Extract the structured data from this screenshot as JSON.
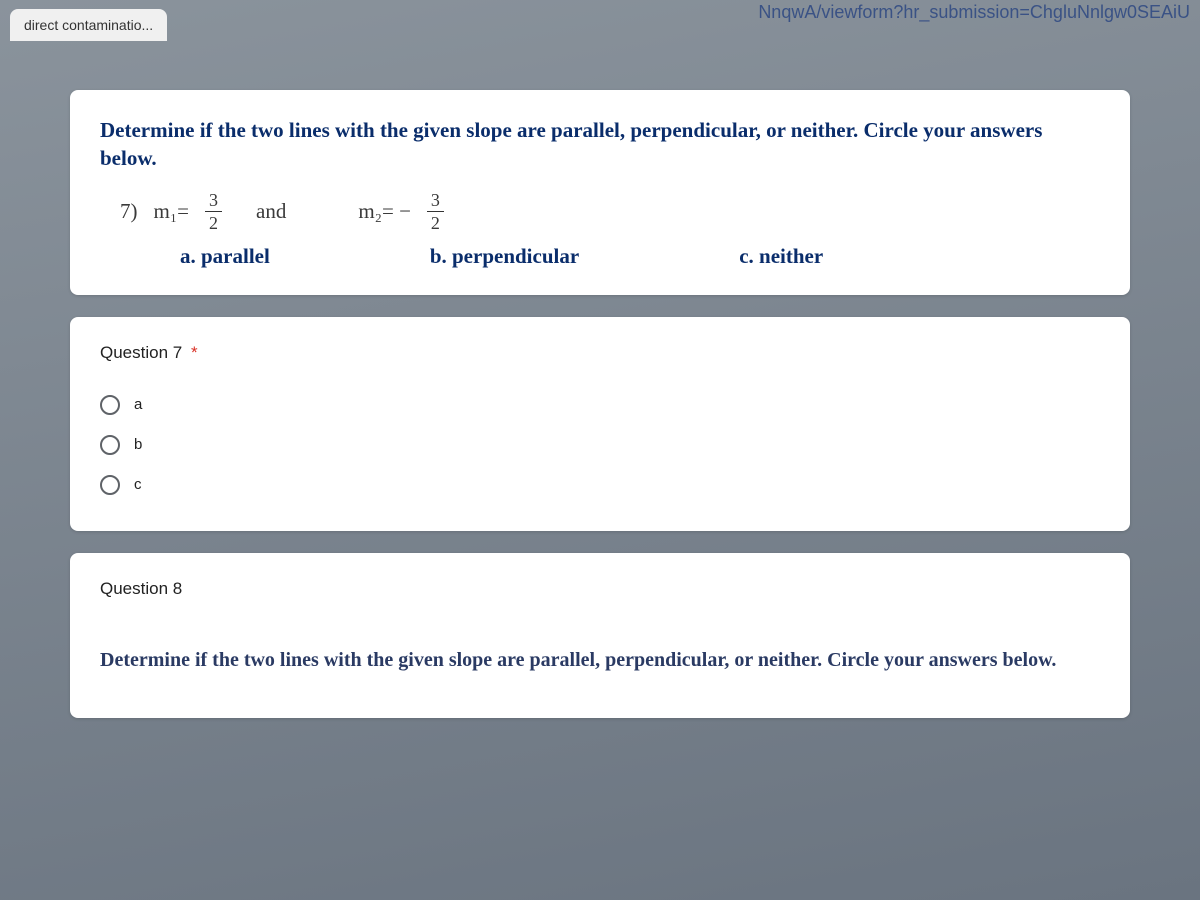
{
  "browser": {
    "tab_title": "direct contaminatio...",
    "url_fragment": "NnqwA/viewform?hr_submission=ChgluNnlgw0SEAiU"
  },
  "card_instruction": {
    "text": "Determine if the two lines with the given slope are parallel, perpendicular, or neither. Circle your answers below."
  },
  "problem": {
    "number": "7)",
    "m1_label": "m₁=",
    "m1_num": "3",
    "m1_den": "2",
    "and": "and",
    "m2_label": "m₂= −",
    "m2_num": "3",
    "m2_den": "2"
  },
  "choices": {
    "a": "a. parallel",
    "b": "b. perpendicular",
    "c": "c. neither"
  },
  "question7": {
    "title": "Question 7",
    "required": "*",
    "options": {
      "a": "a",
      "b": "b",
      "c": "c"
    }
  },
  "question8": {
    "title": "Question 8",
    "instruction": "Determine if the two lines with the given slope are parallel, perpendicular, or neither. Circle your answers below."
  }
}
